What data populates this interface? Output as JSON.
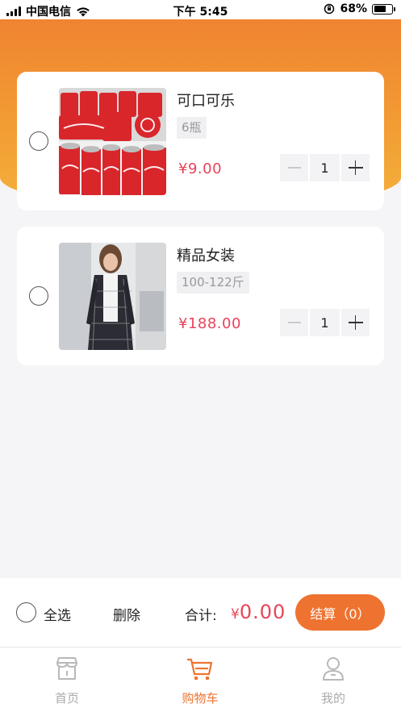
{
  "status_bar": {
    "carrier": "中国电信",
    "time": "下午 5:45",
    "battery": "68%",
    "battery_level": 0.68
  },
  "cart": {
    "items": [
      {
        "title": "可口可乐",
        "spec": "6瓶",
        "price": "¥9.00",
        "quantity": "1",
        "selected": false,
        "image": "cola-cans-photo"
      },
      {
        "title": "精品女装",
        "spec": "100-122斤",
        "price": "¥188.00",
        "quantity": "1",
        "selected": false,
        "image": "womens-plaid-coat-photo"
      }
    ]
  },
  "action_bar": {
    "select_all": "全选",
    "delete": "删除",
    "total_label": "合计:",
    "total_currency": "¥",
    "total_value": "0.00",
    "checkout": "结算（0）"
  },
  "tab_bar": {
    "tabs": [
      {
        "label": "首页",
        "icon": "shop-icon",
        "active": false
      },
      {
        "label": "购物车",
        "icon": "cart-icon",
        "active": true
      },
      {
        "label": "我的",
        "icon": "person-icon",
        "active": false
      }
    ]
  },
  "colors": {
    "accent": "#ee7330",
    "price": "#e8445a",
    "gradient_top": "#ef7f31",
    "gradient_bottom": "#f4b13a"
  }
}
